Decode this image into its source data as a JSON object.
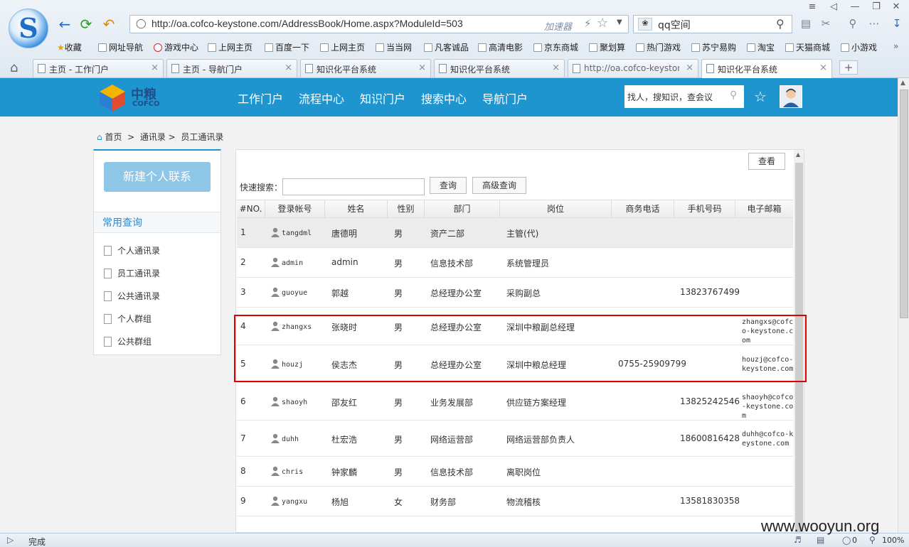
{
  "browser": {
    "url": "http://oa.cofco-keystone.com/AddressBook/Home.aspx?ModuleId=503",
    "accelerator": "加速器",
    "search_text": "qq空间",
    "status": "完成",
    "zoom": "100%",
    "status_count": "0",
    "bookmarks": [
      "收藏",
      "网址导航",
      "游戏中心",
      "上网主页",
      "百度一下",
      "上网主页",
      "当当网",
      "凡客诚品",
      "高清电影",
      "京东商城",
      "聚划算",
      "热门游戏",
      "苏宁易购",
      "淘宝",
      "天猫商城",
      "小游戏"
    ],
    "tabs": [
      "主页 - 工作门户",
      "主页 - 导航门户",
      "知识化平台系统",
      "知识化平台系统",
      "http://oa.cofco-keyston",
      "知识化平台系统"
    ]
  },
  "header": {
    "brand_cn": "中粮",
    "brand_en": "COFCO",
    "nav": [
      "工作门户",
      "流程中心",
      "知识门户",
      "搜索中心",
      "导航门户"
    ],
    "search_placeholder": "找人，搜知识，查会议"
  },
  "breadcrumb": [
    "首页",
    "通讯录",
    "员工通讯录"
  ],
  "left_panel": {
    "new_button": "新建个人联系",
    "section_title": "常用查询",
    "items": [
      "个人通讯录",
      "员工通讯录",
      "公共通讯录",
      "个人群组",
      "公共群组"
    ]
  },
  "grid": {
    "view_button": "查看",
    "quick_search_label": "快速搜索：",
    "query_button": "查询",
    "advanced_button": "高级查询",
    "columns": [
      "#NO.",
      "登录帐号",
      "姓名",
      "性别",
      "部门",
      "岗位",
      "商务电话",
      "手机号码",
      "电子邮箱"
    ],
    "rows": [
      {
        "no": "1",
        "account": "tangdml",
        "name": "唐德明",
        "gender": "男",
        "dept": "资产二部",
        "post": "主管(代)",
        "phone": "",
        "mobile": "",
        "email": ""
      },
      {
        "no": "2",
        "account": "admin",
        "name": "admin",
        "gender": "男",
        "dept": "信息技术部",
        "post": "系统管理员",
        "phone": "",
        "mobile": "",
        "email": ""
      },
      {
        "no": "3",
        "account": "guoyue",
        "name": "郭越",
        "gender": "男",
        "dept": "总经理办公室",
        "post": "采购副总",
        "phone": "",
        "mobile": "13823767499",
        "email": ""
      },
      {
        "no": "4",
        "account": "zhangxs",
        "name": "张晓时",
        "gender": "男",
        "dept": "总经理办公室",
        "post": "深圳中粮副总经理",
        "phone": "",
        "mobile": "",
        "email": "zhangxs@cofco-keystone.com"
      },
      {
        "no": "5",
        "account": "houzj",
        "name": "侯志杰",
        "gender": "男",
        "dept": "总经理办公室",
        "post": "深圳中粮总经理",
        "phone": "0755-25909799",
        "mobile": "",
        "email": "houzj@cofco-keystone.com"
      },
      {
        "no": "6",
        "account": "shaoyh",
        "name": "邵友红",
        "gender": "男",
        "dept": "业务发展部",
        "post": "供应链方案经理",
        "phone": "",
        "mobile": "13825242546",
        "email": "shaoyh@cofco-keystone.com"
      },
      {
        "no": "7",
        "account": "duhh",
        "name": "杜宏浩",
        "gender": "男",
        "dept": "网络运营部",
        "post": "网络运营部负责人",
        "phone": "",
        "mobile": "18600816428",
        "email": "duhh@cofco-keystone.com"
      },
      {
        "no": "8",
        "account": "chris",
        "name": "钟家麟",
        "gender": "男",
        "dept": "信息技术部",
        "post": "离职岗位",
        "phone": "",
        "mobile": "",
        "email": ""
      },
      {
        "no": "9",
        "account": "yangxu",
        "name": "杨旭",
        "gender": "女",
        "dept": "财务部",
        "post": "物流稽核",
        "phone": "",
        "mobile": "13581830358",
        "email": ""
      }
    ]
  },
  "watermark": "www.wooyun.org",
  "colors": {
    "header": "#1f95d0",
    "highlight": "#e00000"
  }
}
